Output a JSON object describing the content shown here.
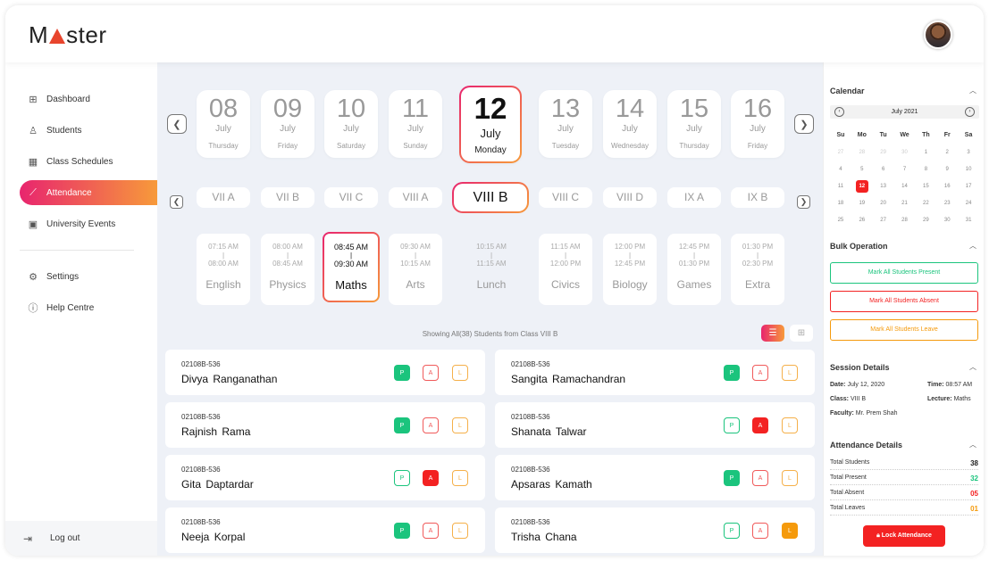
{
  "app": {
    "logo_pre": "M",
    "logo_post": "ster"
  },
  "sidebar": {
    "items": [
      {
        "label": "Dashboard",
        "icon": "grid-icon"
      },
      {
        "label": "Students",
        "icon": "user-icon"
      },
      {
        "label": "Class Schedules",
        "icon": "calendar-icon"
      },
      {
        "label": "Attendance",
        "icon": "chart-icon"
      },
      {
        "label": "University Events",
        "icon": "event-icon"
      },
      {
        "label": "Settings",
        "icon": "gear-icon"
      },
      {
        "label": "Help Centre",
        "icon": "help-icon"
      }
    ],
    "logout": "Log out"
  },
  "dates": [
    {
      "d": "08",
      "m": "July",
      "w": "Thursday"
    },
    {
      "d": "09",
      "m": "July",
      "w": "Friday"
    },
    {
      "d": "10",
      "m": "July",
      "w": "Saturday"
    },
    {
      "d": "11",
      "m": "July",
      "w": "Sunday"
    },
    {
      "d": "12",
      "m": "July",
      "w": "Monday"
    },
    {
      "d": "13",
      "m": "July",
      "w": "Tuesday"
    },
    {
      "d": "14",
      "m": "July",
      "w": "Wednesday"
    },
    {
      "d": "15",
      "m": "July",
      "w": "Thursday"
    },
    {
      "d": "16",
      "m": "July",
      "w": "Friday"
    }
  ],
  "classes": [
    "VII A",
    "VII B",
    "VII C",
    "VIII A",
    "VIII B",
    "VIII C",
    "VIII D",
    "IX A",
    "IX B"
  ],
  "schedule": [
    {
      "from": "07:15 AM",
      "to": "08:00 AM",
      "sep": "|",
      "subject": "English"
    },
    {
      "from": "08:00 AM",
      "to": "08:45 AM",
      "sep": "|",
      "subject": "Physics"
    },
    {
      "from": "08:45 AM",
      "to": "09:30 AM",
      "sep": "|",
      "subject": "Maths"
    },
    {
      "from": "09:30 AM",
      "to": "10:15 AM",
      "sep": "|",
      "subject": "Arts"
    },
    {
      "from": "10:15 AM",
      "to": "11:15 AM",
      "sep": "|",
      "subject": "Lunch"
    },
    {
      "from": "11:15 AM",
      "to": "12:00 PM",
      "sep": "|",
      "subject": "Civics"
    },
    {
      "from": "12:00 PM",
      "to": "12:45 PM",
      "sep": "|",
      "subject": "Biology"
    },
    {
      "from": "12:45 PM",
      "to": "01:30 PM",
      "sep": "|",
      "subject": "Games"
    },
    {
      "from": "01:30 PM",
      "to": "02:30 PM",
      "sep": "|",
      "subject": "Extra"
    }
  ],
  "showing": "Showing All(38) Students from Class VIII B",
  "students": [
    {
      "id": "02108B-536",
      "name": "Divya Ranganathan",
      "status": "P"
    },
    {
      "id": "02108B-536",
      "name": "Sangita Ramachandran",
      "status": "P"
    },
    {
      "id": "02108B-536",
      "name": "Rajnish Rama",
      "status": "P"
    },
    {
      "id": "02108B-536",
      "name": "Shanata Talwar",
      "status": "A"
    },
    {
      "id": "02108B-536",
      "name": "Gita Daptardar",
      "status": "A"
    },
    {
      "id": "02108B-536",
      "name": "Apsaras Kamath",
      "status": "P"
    },
    {
      "id": "02108B-536",
      "name": "Neeja Korpal",
      "status": "P"
    },
    {
      "id": "02108B-536",
      "name": "Trisha Chana",
      "status": "L"
    }
  ],
  "att_labels": {
    "p": "P",
    "a": "A",
    "l": "L"
  },
  "calendar": {
    "title": "Calendar",
    "month": "July 2021",
    "days": [
      "Su",
      "Mo",
      "Tu",
      "We",
      "Th",
      "Fr",
      "Sa"
    ],
    "weeks": [
      [
        "27",
        "28",
        "29",
        "30",
        "1",
        "2",
        "3"
      ],
      [
        "4",
        "5",
        "6",
        "7",
        "8",
        "9",
        "10"
      ],
      [
        "11",
        "12",
        "13",
        "14",
        "15",
        "16",
        "17"
      ],
      [
        "18",
        "19",
        "20",
        "21",
        "22",
        "23",
        "24"
      ],
      [
        "25",
        "26",
        "27",
        "28",
        "29",
        "30",
        "31"
      ]
    ],
    "today": "12"
  },
  "bulk": {
    "title": "Bulk Operation",
    "present": "Mark All Students Present",
    "absent": "Mark All Students Absent",
    "leave": "Mark All Students Leave"
  },
  "session": {
    "title": "Session Details",
    "date_label": "Date:",
    "date": "July 12, 2020",
    "time_label": "Time:",
    "time": "08:57 AM",
    "class_label": "Class:",
    "class": "VIII B",
    "lecture_label": "Lecture:",
    "lecture": "Maths",
    "faculty_label": "Faculty:",
    "faculty": "Mr. Prem Shah"
  },
  "attendance": {
    "title": "Attendance Details",
    "rows": [
      {
        "label": "Total Students",
        "value": "38",
        "color": "#222222"
      },
      {
        "label": "Total Present",
        "value": "32",
        "color": "#1bc47d"
      },
      {
        "label": "Total Absent",
        "value": "05",
        "color": "#f32222"
      },
      {
        "label": "Total Leaves",
        "value": "01",
        "color": "#f59a0c"
      }
    ],
    "lock": "Lock Attendance"
  },
  "colors": {
    "accent_start": "#e8256e",
    "accent_end": "#f79a3a",
    "present": "#1bc47d",
    "absent": "#f32222",
    "leave": "#f59a0c"
  }
}
